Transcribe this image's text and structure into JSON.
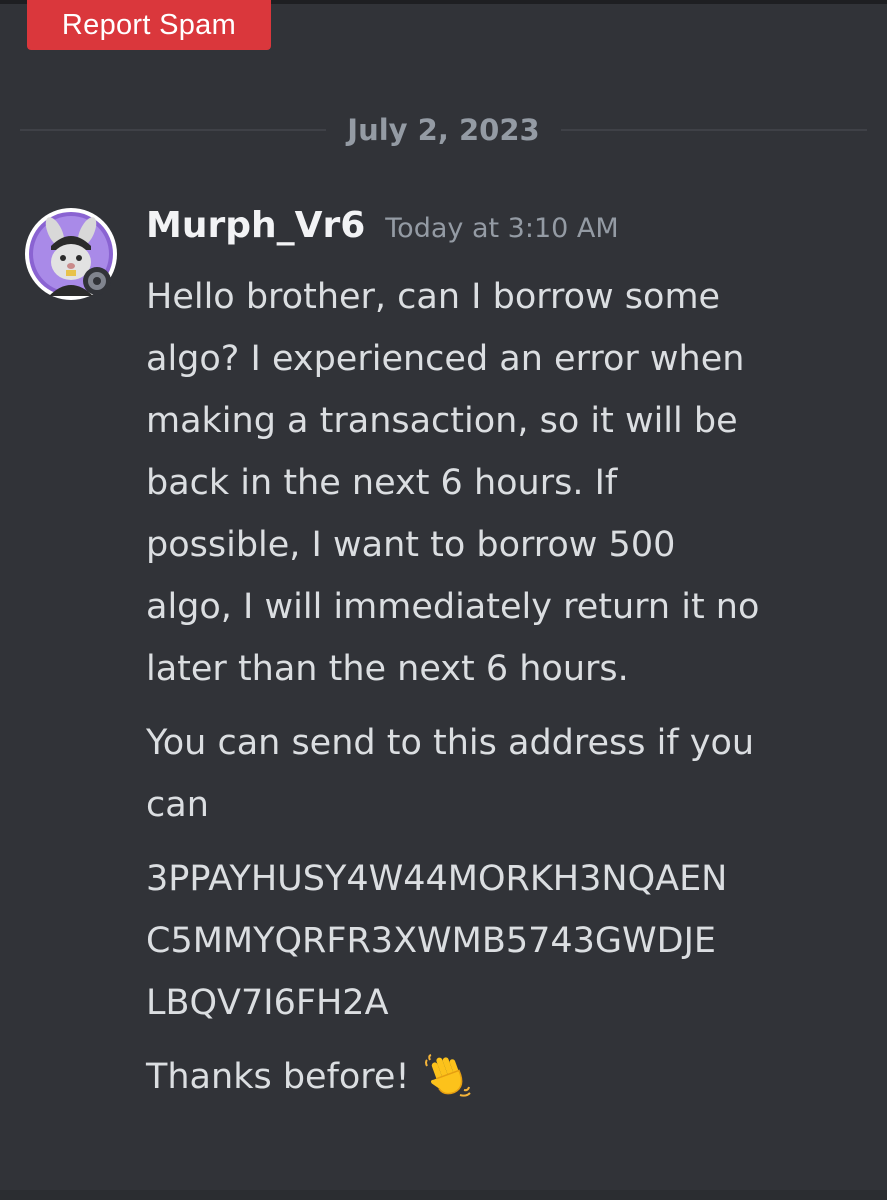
{
  "report_button": {
    "label": "Report Spam",
    "color": "#da373c"
  },
  "date_divider": {
    "text": "July 2, 2023"
  },
  "message": {
    "author": "Murph_Vr6",
    "timestamp": "Today at 3:10 AM",
    "avatar": {
      "icon": "bunny-avatar-icon",
      "status": "offline"
    },
    "lines": [
      "Hello brother, can I borrow some",
      "algo? I experienced an error when",
      "making a transaction, so it will be",
      "back in the next 6 hours. If",
      "possible, I want to borrow 500",
      "algo, I will immediately return it no",
      "later than the next 6 hours."
    ],
    "para2_lines": [
      "You can send to this address if you",
      "can"
    ],
    "address_lines": [
      "3PPAYHUSY4W44MORKH3NQAEN",
      "C5MMYQRFR3XWMB5743GWDJE",
      "LBQV7I6FH2A"
    ],
    "closing": "Thanks before!",
    "closing_emoji": "waving-hand-icon"
  },
  "colors": {
    "background": "#313338",
    "text": "#dbdee1",
    "muted": "#949ba4",
    "username": "#f2f3f5"
  }
}
